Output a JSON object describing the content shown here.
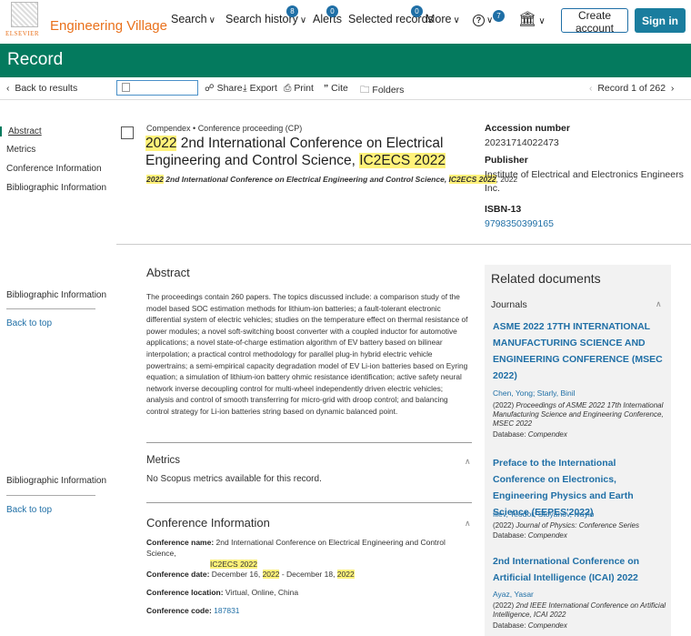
{
  "header": {
    "logo_word": "ELSEVIER",
    "brand": "Engineering Village",
    "nav": {
      "search": "Search",
      "history": "Search history",
      "history_badge": "8",
      "alerts": "Alerts",
      "alerts_badge": "0",
      "selected": "Selected records",
      "selected_badge": "0",
      "more": "More",
      "help_badge": "7"
    },
    "create_account": "Create account",
    "sign_in": "Sign in"
  },
  "band": {
    "title": "Record"
  },
  "toolbar": {
    "back": "Back to results",
    "share": "Share",
    "export": "Export",
    "print": "Print",
    "cite": "Cite",
    "folders": "Folders",
    "record_counter": "Record 1 of 262"
  },
  "left_nav": {
    "abstract": "Abstract",
    "metrics": "Metrics",
    "conference": "Conference Information",
    "bibliographic": "Bibliographic Information",
    "bib_repeat": "Bibliographic Information",
    "back_to_top": "Back to top"
  },
  "record": {
    "source_db": "Compendex",
    "doc_type": "Conference proceeding (CP)",
    "title_year": "2022",
    "title_main": " 2nd International Conference on Electrical Engineering and Control Science, ",
    "title_acronym": "IC2ECS 2022",
    "cite_year": "2022",
    "cite_main": " 2nd International Conference on Electrical Engineering and Control Science, ",
    "cite_acronym": "IC2ECS 2022",
    "cite_tail": ", 2022"
  },
  "meta": {
    "accession_label": "Accession number",
    "accession_value": "20231714022473",
    "publisher_label": "Publisher",
    "publisher_value": "Institute of Electrical and Electronics Engineers Inc.",
    "isbn_label": "ISBN-13",
    "isbn_value": "9798350399165"
  },
  "abstract": {
    "heading": "Abstract",
    "text": "The proceedings contain 260 papers. The topics discussed include: a comparison study of the model based SOC estimation methods for lithium-ion batteries; a fault-tolerant electronic differential system of electric vehicles; studies on the temperature effect on thermal resistance of power modules; a novel soft-switching boost converter with a coupled inductor for automotive applications; a novel state-of-charge estimation algorithm of EV battery based on bilinear interpolation; a practical control methodology for parallel plug-in hybrid electric vehicle powertrains; a semi-empirical capacity degradation model of EV Li-ion batteries based on Eyring equation; a simulation of lithium-ion battery ohmic resistance identification; active safety neural network inverse decoupling control for multi-wheel independently driven electric vehicles; analysis and control of smooth transferring for micro-grid with droop control; and balancing control strategy for Li-ion batteries string based on dynamic balanced point."
  },
  "metrics": {
    "heading": "Metrics",
    "text": "No Scopus metrics available for this record."
  },
  "conference": {
    "heading": "Conference Information",
    "name_label": "Conference name:",
    "name_value": " 2nd International Conference on Electrical Engineering and Control Science,",
    "name_acronym": "IC2ECS 2022",
    "date_label": "Conference date:",
    "date_a": " December 16, ",
    "date_year1": "2022",
    "date_b": " - December 18, ",
    "date_year2": "2022",
    "location_label": "Conference location:",
    "location_value": " Virtual, Online, China",
    "code_label": "Conference code:",
    "code_value": "187831"
  },
  "related": {
    "heading": "Related documents",
    "journals_label": "Journals",
    "items": [
      {
        "title": "ASME 2022 17TH INTERNATIONAL MANUFACTURING SCIENCE AND ENGINEERING CONFERENCE (MSEC 2022)",
        "authors": "Chen, Yong; Starly, Binil",
        "year": "(2022) ",
        "source": "Proceedings of ASME 2022 17th International Manufacturing Science and Engineering Conference, MSEC 2022",
        "db_label": "Database: ",
        "db": "Compendex"
      },
      {
        "title": "Preface to the International Conference on Electronics, Engineering Physics and Earth Science (EEPES'2022)",
        "authors": "Iliev, Teodor; Stoyanov, Ivaylo",
        "year": "(2022) ",
        "source": "Journal of Physics: Conference Series",
        "db_label": "Database: ",
        "db": "Compendex"
      },
      {
        "title": "2nd International Conference on Artificial Intelligence (ICAI) 2022",
        "authors": "Ayaz, Yasar",
        "year": "(2022) ",
        "source": "2nd IEEE International Conference on Artificial Intelligence, ICAI 2022",
        "db_label": "Database: ",
        "db": "Compendex"
      }
    ]
  }
}
